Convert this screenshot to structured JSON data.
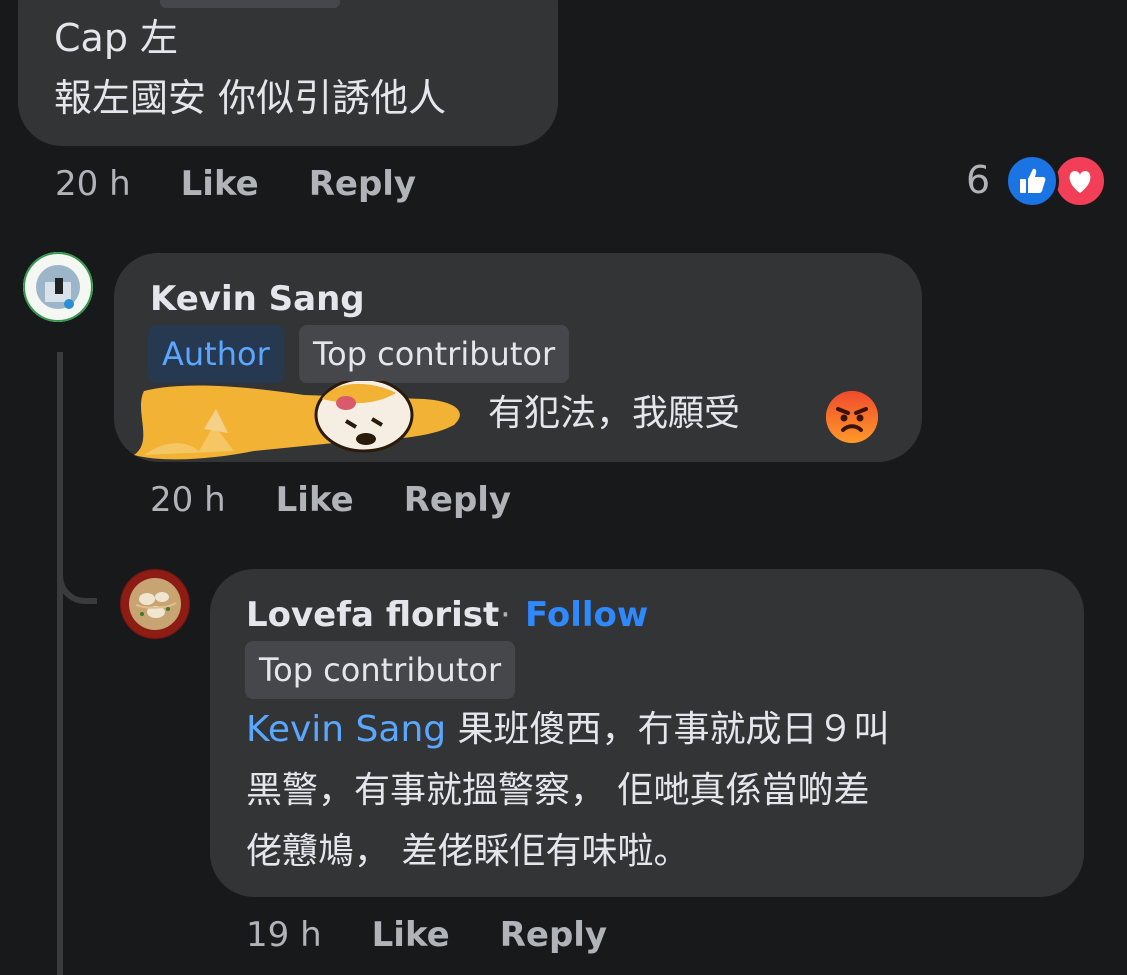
{
  "colors": {
    "background": "#18191a",
    "bubble": "#333436",
    "mention": "#5aa7ff",
    "follow": "#2e89ff",
    "like_reaction": "#1b74e4",
    "love_reaction": "#f33e58"
  },
  "comment1": {
    "lines": [
      "Cap 左",
      "報左國安 你似引誘他人"
    ],
    "time": "20 h",
    "like_label": "Like",
    "reply_label": "Reply",
    "reaction_count": "6",
    "reactions": [
      "like-icon",
      "love-icon"
    ]
  },
  "comment2": {
    "author": "Kevin Sang",
    "badges": [
      "Author",
      "Top contributor"
    ],
    "text": "有犯法，我願受",
    "sticker": "shiba-dog-sticker",
    "emoji": "angry-face-icon",
    "time": "20 h",
    "like_label": "Like",
    "reply_label": "Reply"
  },
  "comment3": {
    "author": "Lovefa florist",
    "separator": "·",
    "follow_label": "Follow",
    "badges": [
      "Top contributor"
    ],
    "mention": "Kevin Sang",
    "text_line1": " 果班傻西，冇事就成日９叫",
    "text_line2": "黑警，有事就搵警察， 佢哋真係當啲差",
    "text_line3": "佬戇鳩， 差佬睬佢有味啦。",
    "time": "19 h",
    "like_label": "Like",
    "reply_label": "Reply"
  }
}
